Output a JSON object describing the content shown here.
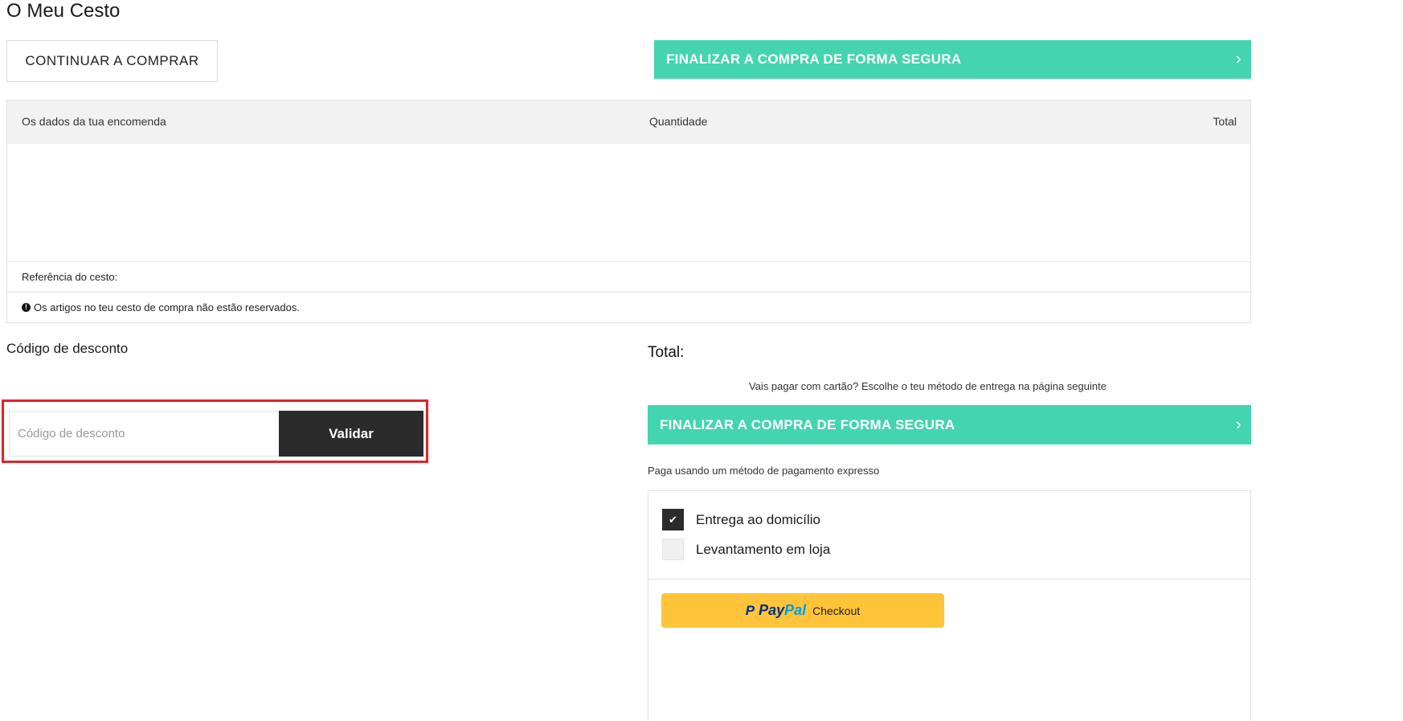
{
  "page": {
    "title": "O Meu Cesto"
  },
  "actions": {
    "continue_label": "CONTINUAR A COMPRAR",
    "checkout_label": "FINALIZAR A COMPRA DE FORMA SEGURA",
    "chevron": "›"
  },
  "order": {
    "headers": {
      "details": "Os dados da tua encomenda",
      "quantity": "Quantidade",
      "total": "Total"
    },
    "reference_label": "Referência do cesto:",
    "info_icon": "!",
    "not_reserved_note": "Os artigos no teu cesto de compra não estão reservados."
  },
  "discount": {
    "title": "Código de desconto",
    "placeholder": "Código de desconto",
    "validate_label": "Validar"
  },
  "summary": {
    "total_label": "Total:",
    "card_note": "Vais pagar com cartão? Escolhe o teu método de entrega na página seguinte",
    "express_note": "Paga usando um método de pagamento expresso"
  },
  "delivery": {
    "options": [
      {
        "label": "Entrega ao domicílio",
        "checked": true,
        "mark": "✔"
      },
      {
        "label": "Levantamento em loja",
        "checked": false,
        "mark": ""
      }
    ]
  },
  "paypal": {
    "mark": "P",
    "word_part1": "Pay",
    "word_part2": "Pal",
    "checkout_label": "Checkout"
  },
  "colors": {
    "accent": "#45d4b0",
    "dark_button": "#2b2b2b",
    "highlight_border": "#e0242b",
    "paypal_yellow": "#ffc439"
  }
}
